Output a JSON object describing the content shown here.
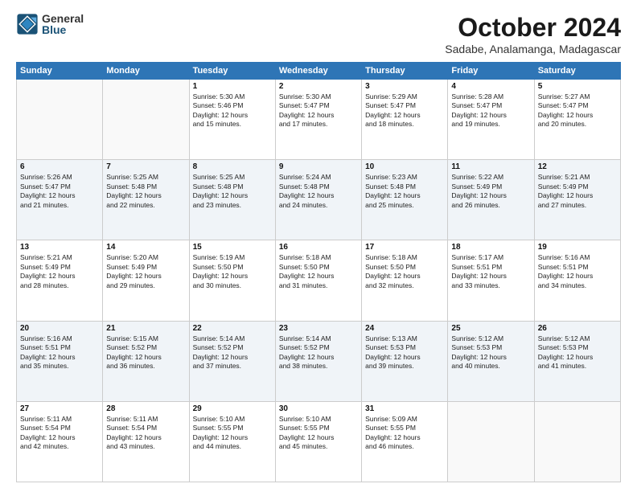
{
  "logo": {
    "general": "General",
    "blue": "Blue"
  },
  "header": {
    "title": "October 2024",
    "subtitle": "Sadabe, Analamanga, Madagascar"
  },
  "weekdays": [
    "Sunday",
    "Monday",
    "Tuesday",
    "Wednesday",
    "Thursday",
    "Friday",
    "Saturday"
  ],
  "weeks": [
    [
      {
        "day": "",
        "info": ""
      },
      {
        "day": "",
        "info": ""
      },
      {
        "day": "1",
        "info": "Sunrise: 5:30 AM\nSunset: 5:46 PM\nDaylight: 12 hours\nand 15 minutes."
      },
      {
        "day": "2",
        "info": "Sunrise: 5:30 AM\nSunset: 5:47 PM\nDaylight: 12 hours\nand 17 minutes."
      },
      {
        "day": "3",
        "info": "Sunrise: 5:29 AM\nSunset: 5:47 PM\nDaylight: 12 hours\nand 18 minutes."
      },
      {
        "day": "4",
        "info": "Sunrise: 5:28 AM\nSunset: 5:47 PM\nDaylight: 12 hours\nand 19 minutes."
      },
      {
        "day": "5",
        "info": "Sunrise: 5:27 AM\nSunset: 5:47 PM\nDaylight: 12 hours\nand 20 minutes."
      }
    ],
    [
      {
        "day": "6",
        "info": "Sunrise: 5:26 AM\nSunset: 5:47 PM\nDaylight: 12 hours\nand 21 minutes."
      },
      {
        "day": "7",
        "info": "Sunrise: 5:25 AM\nSunset: 5:48 PM\nDaylight: 12 hours\nand 22 minutes."
      },
      {
        "day": "8",
        "info": "Sunrise: 5:25 AM\nSunset: 5:48 PM\nDaylight: 12 hours\nand 23 minutes."
      },
      {
        "day": "9",
        "info": "Sunrise: 5:24 AM\nSunset: 5:48 PM\nDaylight: 12 hours\nand 24 minutes."
      },
      {
        "day": "10",
        "info": "Sunrise: 5:23 AM\nSunset: 5:48 PM\nDaylight: 12 hours\nand 25 minutes."
      },
      {
        "day": "11",
        "info": "Sunrise: 5:22 AM\nSunset: 5:49 PM\nDaylight: 12 hours\nand 26 minutes."
      },
      {
        "day": "12",
        "info": "Sunrise: 5:21 AM\nSunset: 5:49 PM\nDaylight: 12 hours\nand 27 minutes."
      }
    ],
    [
      {
        "day": "13",
        "info": "Sunrise: 5:21 AM\nSunset: 5:49 PM\nDaylight: 12 hours\nand 28 minutes."
      },
      {
        "day": "14",
        "info": "Sunrise: 5:20 AM\nSunset: 5:49 PM\nDaylight: 12 hours\nand 29 minutes."
      },
      {
        "day": "15",
        "info": "Sunrise: 5:19 AM\nSunset: 5:50 PM\nDaylight: 12 hours\nand 30 minutes."
      },
      {
        "day": "16",
        "info": "Sunrise: 5:18 AM\nSunset: 5:50 PM\nDaylight: 12 hours\nand 31 minutes."
      },
      {
        "day": "17",
        "info": "Sunrise: 5:18 AM\nSunset: 5:50 PM\nDaylight: 12 hours\nand 32 minutes."
      },
      {
        "day": "18",
        "info": "Sunrise: 5:17 AM\nSunset: 5:51 PM\nDaylight: 12 hours\nand 33 minutes."
      },
      {
        "day": "19",
        "info": "Sunrise: 5:16 AM\nSunset: 5:51 PM\nDaylight: 12 hours\nand 34 minutes."
      }
    ],
    [
      {
        "day": "20",
        "info": "Sunrise: 5:16 AM\nSunset: 5:51 PM\nDaylight: 12 hours\nand 35 minutes."
      },
      {
        "day": "21",
        "info": "Sunrise: 5:15 AM\nSunset: 5:52 PM\nDaylight: 12 hours\nand 36 minutes."
      },
      {
        "day": "22",
        "info": "Sunrise: 5:14 AM\nSunset: 5:52 PM\nDaylight: 12 hours\nand 37 minutes."
      },
      {
        "day": "23",
        "info": "Sunrise: 5:14 AM\nSunset: 5:52 PM\nDaylight: 12 hours\nand 38 minutes."
      },
      {
        "day": "24",
        "info": "Sunrise: 5:13 AM\nSunset: 5:53 PM\nDaylight: 12 hours\nand 39 minutes."
      },
      {
        "day": "25",
        "info": "Sunrise: 5:12 AM\nSunset: 5:53 PM\nDaylight: 12 hours\nand 40 minutes."
      },
      {
        "day": "26",
        "info": "Sunrise: 5:12 AM\nSunset: 5:53 PM\nDaylight: 12 hours\nand 41 minutes."
      }
    ],
    [
      {
        "day": "27",
        "info": "Sunrise: 5:11 AM\nSunset: 5:54 PM\nDaylight: 12 hours\nand 42 minutes."
      },
      {
        "day": "28",
        "info": "Sunrise: 5:11 AM\nSunset: 5:54 PM\nDaylight: 12 hours\nand 43 minutes."
      },
      {
        "day": "29",
        "info": "Sunrise: 5:10 AM\nSunset: 5:55 PM\nDaylight: 12 hours\nand 44 minutes."
      },
      {
        "day": "30",
        "info": "Sunrise: 5:10 AM\nSunset: 5:55 PM\nDaylight: 12 hours\nand 45 minutes."
      },
      {
        "day": "31",
        "info": "Sunrise: 5:09 AM\nSunset: 5:55 PM\nDaylight: 12 hours\nand 46 minutes."
      },
      {
        "day": "",
        "info": ""
      },
      {
        "day": "",
        "info": ""
      }
    ]
  ]
}
